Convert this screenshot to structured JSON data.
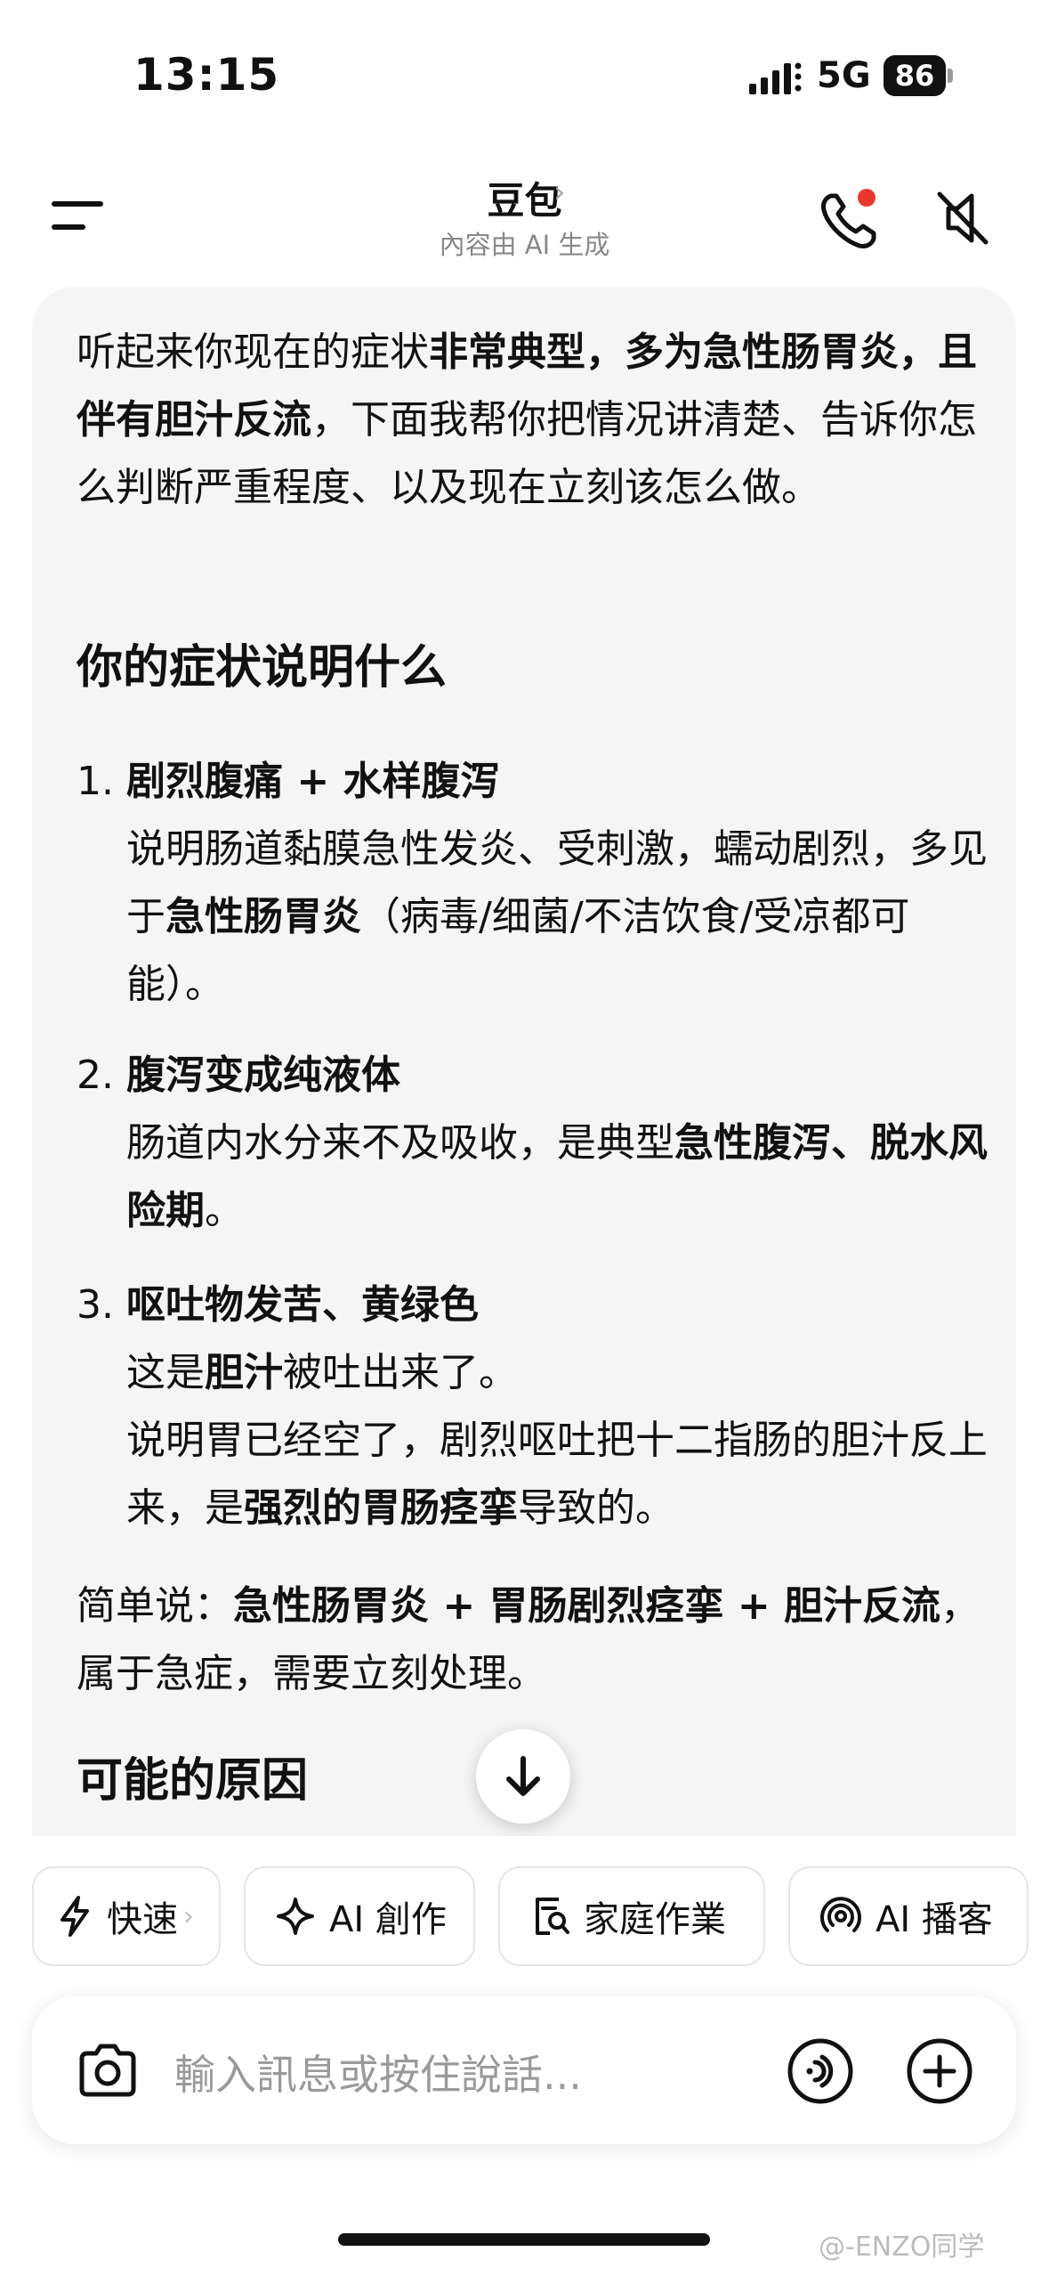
{
  "status_bar": {
    "time": "13:15",
    "network": "5G",
    "battery": "86"
  },
  "header": {
    "title": "豆包",
    "subtitle": "內容由 AI 生成",
    "title_chevron": "›"
  },
  "message": {
    "intro": {
      "p1": "听起来你现在的症状",
      "b1": "非常典型，多为急性肠胃炎，且伴有胆汁反流",
      "p2": "，下面我帮你把情况讲清楚、告诉你怎么判断严重程度、以及现在立刻该怎么做。"
    },
    "section1_title": "你的症状说明什么",
    "items": [
      {
        "num": "1.",
        "title": "剧烈腹痛 + 水样腹泻",
        "p1": "说明肠道黏膜急性发炎、受刺激，蠕动剧烈，多见于",
        "b1": "急性肠胃炎",
        "p2": "（病毒/细菌/不洁饮食/受凉都可能）。"
      },
      {
        "num": "2.",
        "title": "腹泻变成纯液体",
        "p1": "肠道内水分来不及吸收，是典型",
        "b1": "急性腹泻、脱水风险期",
        "p2": "。"
      },
      {
        "num": "3.",
        "title": "呕吐物发苦、黄绿色",
        "p1": "这是",
        "b1": "胆汁",
        "p2": "被吐出来了。",
        "p3": "说明胃已经空了，剧烈呕吐把十二指肠的胆汁反上来，是",
        "b2": "强烈的胃肠痉挛",
        "p4": "导致的。"
      }
    ],
    "summary": {
      "p1": "简单说：",
      "b1": "急性肠胃炎 + 胃肠剧烈痉挛 + 胆汁反流",
      "p2": "，属于急症，需要立刻处理。"
    },
    "section2_title": "可能的原因"
  },
  "chips": [
    {
      "label": "快速",
      "icon": "lightning-icon",
      "chevron": "›"
    },
    {
      "label": "AI 創作",
      "icon": "sparkle-icon"
    },
    {
      "label": "家庭作業",
      "icon": "homework-icon"
    },
    {
      "label": "AI 播客",
      "icon": "podcast-icon"
    }
  ],
  "input": {
    "placeholder": "輸入訊息或按住說話..."
  },
  "watermark": "@-ENZO同学",
  "colors": {
    "notification_dot": "#e8382e",
    "bubble_bg": "#f5f5f5",
    "placeholder": "#9a9a9a"
  }
}
